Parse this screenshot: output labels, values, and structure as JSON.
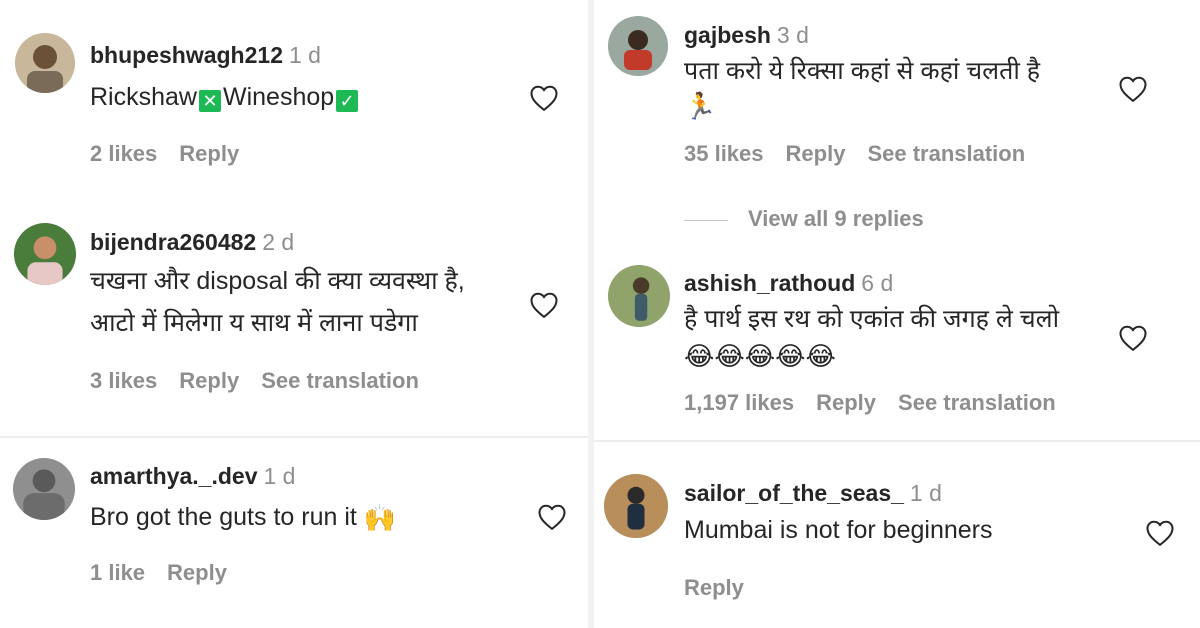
{
  "left": [
    {
      "username": "bhupeshwagh212",
      "time": "1 d",
      "text_parts": [
        "Rickshaw",
        "Wineshop"
      ],
      "likes": "2 likes",
      "reply": "Reply"
    },
    {
      "username": "bijendra260482",
      "time": "2 d",
      "line1": "चखना और disposal की क्या व्यवस्था है,",
      "line2": "आटो में मिलेगा य साथ में लाना पडेगा",
      "likes": "3 likes",
      "reply": "Reply",
      "translate": "See translation"
    },
    {
      "username": "amarthya._.dev",
      "time": "1 d",
      "text": "Bro got the guts to run it",
      "likes": "1 like",
      "reply": "Reply"
    }
  ],
  "right": [
    {
      "username": "gajbesh",
      "time": "3 d",
      "text": "पता करो ये रिक्सा कहां से कहां चलती है",
      "likes": "35 likes",
      "reply": "Reply",
      "translate": "See translation",
      "view_replies": "View all 9 replies"
    },
    {
      "username": "ashish_rathoud",
      "time": "6 d",
      "text": "है पार्थ इस रथ को एकांत की जगह ले चलो",
      "likes": "1,197 likes",
      "reply": "Reply",
      "translate": "See translation"
    },
    {
      "username": "sailor_of_the_seas_",
      "time": "1 d",
      "text": "Mumbai is not for beginners",
      "reply": "Reply"
    }
  ],
  "icons": {
    "box_mark": "✕",
    "check_mark": "✓",
    "pray_emoji": "🙌",
    "runner_emoji": "🏃",
    "laugh_emoji": "😂😂😂😂😂"
  },
  "colors": {
    "muted": "#8e8e8e",
    "text": "#262626",
    "green_box": "#1db954"
  }
}
